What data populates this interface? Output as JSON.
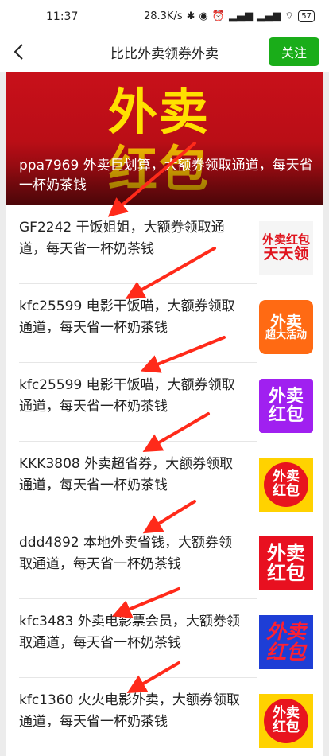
{
  "status_bar": {
    "time": "11:37",
    "speed": "28.3K/s",
    "battery": "57"
  },
  "nav": {
    "title": "比比外卖领券外卖",
    "follow_label": "关注"
  },
  "banner": {
    "big_text_1": "外卖",
    "big_text_2": "红包",
    "caption": "ppa7969 外卖巨划算，大额券领取通道，每天省一杯奶茶钱"
  },
  "items": [
    {
      "text": "GF2242 干饭姐姐，大额券领取通道，每天省一杯奶茶钱",
      "thumb_line1": "外卖红包",
      "thumb_line2": "天天领",
      "thumb_bg": "#f5f5f5",
      "thumb_color": "#e0141e"
    },
    {
      "text": "kfc25599 电影干饭喵，大额券领取通道，每天省一杯奶茶钱",
      "thumb_line1": "外卖",
      "thumb_line2": "超大活动",
      "thumb_bg": "#ff6a13",
      "thumb_color": "#ffffff"
    },
    {
      "text": "kfc25599 电影干饭喵，大额券领取通道，每天省一杯奶茶钱",
      "thumb_line1": "外卖",
      "thumb_line2": "红包",
      "thumb_bg": "#a020f0",
      "thumb_color": "#ffffff"
    },
    {
      "text": "KKK3808 外卖超省券，大额券领取通道，每天省一杯奶茶钱",
      "thumb_line1": "外卖",
      "thumb_line2": "红包",
      "thumb_bg": "#ffd200",
      "thumb_color": "#ffffff"
    },
    {
      "text": "ddd4892 本地外卖省钱，大额券领取通道，每天省一杯奶茶钱",
      "thumb_line1": "外卖",
      "thumb_line2": "红包",
      "thumb_bg": "#e81020",
      "thumb_color": "#ffffff"
    },
    {
      "text": "kfc3483 外卖电影票会员，大额券领取通道，每天省一杯奶茶钱",
      "thumb_line1": "外卖",
      "thumb_line2": "红包",
      "thumb_bg": "#1e3ed6",
      "thumb_color": "#ff2030"
    },
    {
      "text": "kfc1360 火火电影外卖，大额券领取通道，每天省一杯奶茶钱",
      "thumb_line1": "外卖",
      "thumb_line2": "红包",
      "thumb_bg": "#ffd200",
      "thumb_color": "#ffffff"
    }
  ]
}
